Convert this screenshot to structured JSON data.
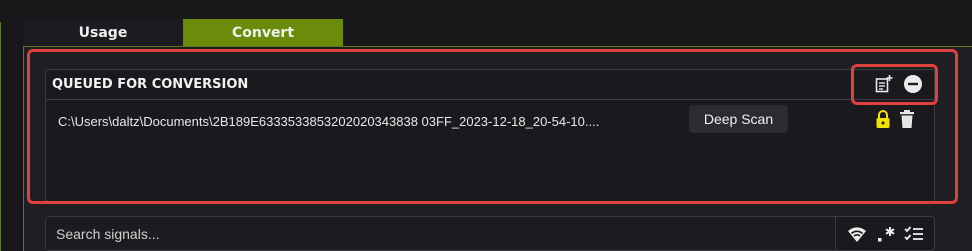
{
  "tabs": [
    {
      "label": "Usage"
    },
    {
      "label": "Convert"
    }
  ],
  "queue": {
    "title": "QUEUED FOR CONVERSION",
    "add_icon": "add-file-icon",
    "remove_icon": "remove-circle-icon",
    "items": [
      {
        "path": "C:\\Users\\daltz\\Documents\\2B189E6333533853202020343838 03FF_2023-12-18_20-54-10....",
        "scan_label": "Deep Scan",
        "lock_icon": "lock-icon",
        "delete_icon": "trash-icon"
      }
    ]
  },
  "search": {
    "placeholder": "Search signals...",
    "tools": [
      "wifi-signal-icon",
      "regex-icon",
      "checklist-icon"
    ]
  },
  "colors": {
    "accent": "#6a8c0a",
    "highlight": "#e0403e",
    "lock": "#f2e200"
  }
}
